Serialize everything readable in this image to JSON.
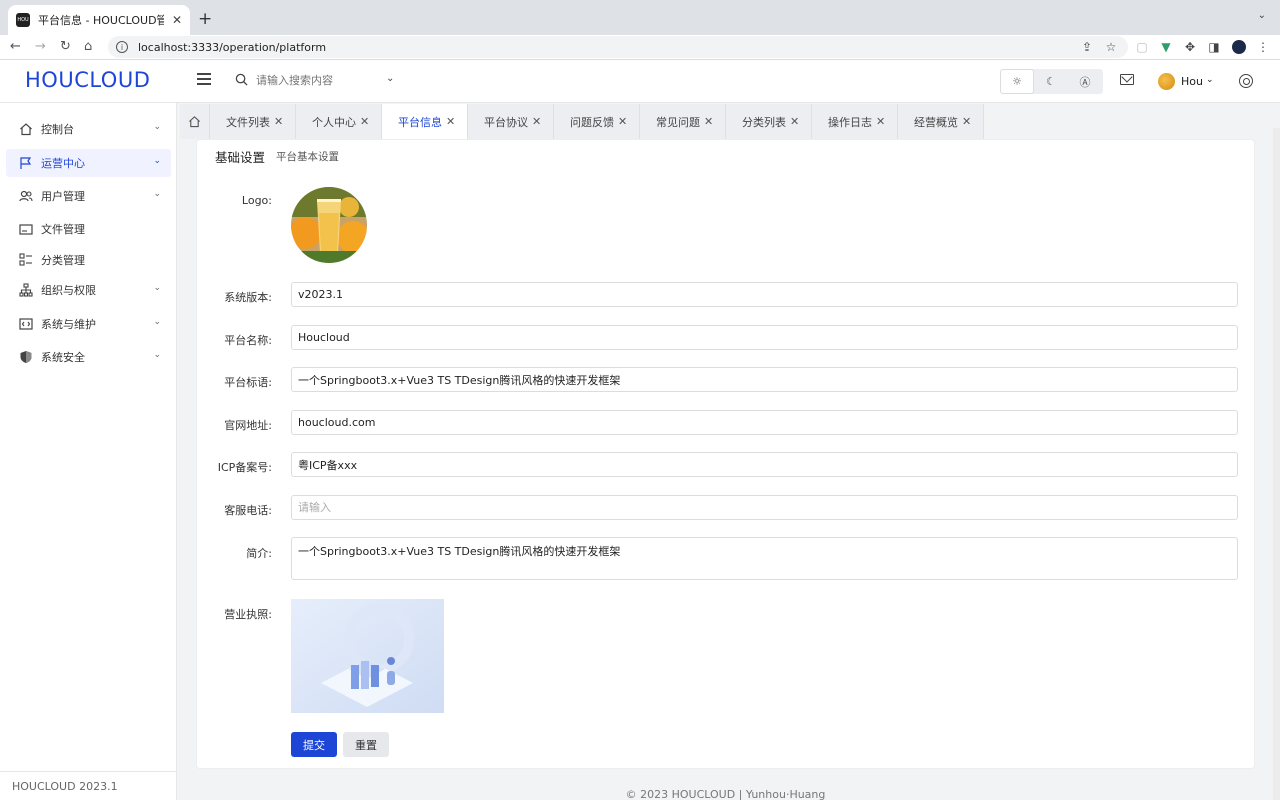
{
  "browser": {
    "tab_title": "平台信息 - HOUCLOUD管理端",
    "tab_favicon": "HOU",
    "url": "localhost:3333/operation/platform",
    "new_tab": "+",
    "close": "✕"
  },
  "header": {
    "logo": "HOUCLOUD",
    "search_placeholder": "请输入搜索内容",
    "user_name": "Hou",
    "theme_options": [
      "light-theme-icon",
      "dark-theme-icon",
      "auto-theme-icon"
    ]
  },
  "sidebar": {
    "items": [
      {
        "label": "控制台",
        "icon": "home-icon",
        "expandable": true
      },
      {
        "label": "运营中心",
        "icon": "flag-icon",
        "expandable": true,
        "active": true
      },
      {
        "label": "用户管理",
        "icon": "users-icon",
        "expandable": true
      },
      {
        "label": "文件管理",
        "icon": "folder-icon",
        "expandable": false
      },
      {
        "label": "分类管理",
        "icon": "category-icon",
        "expandable": false
      },
      {
        "label": "组织与权限",
        "icon": "org-icon",
        "expandable": true
      },
      {
        "label": "系统与维护",
        "icon": "code-icon",
        "expandable": true
      },
      {
        "label": "系统安全",
        "icon": "shield-icon",
        "expandable": true
      }
    ],
    "footer": "HOUCLOUD 2023.1"
  },
  "tabs": [
    {
      "label": "文件列表"
    },
    {
      "label": "个人中心"
    },
    {
      "label": "平台信息",
      "active": true
    },
    {
      "label": "平台协议"
    },
    {
      "label": "问题反馈"
    },
    {
      "label": "常见问题"
    },
    {
      "label": "分类列表"
    },
    {
      "label": "操作日志"
    },
    {
      "label": "经营概览"
    }
  ],
  "card": {
    "title": "基础设置",
    "subtitle": "平台基本设置"
  },
  "form": {
    "logo_label": "Logo:",
    "version_label": "系统版本:",
    "version_value": "v2023.1",
    "name_label": "平台名称:",
    "name_value": "Houcloud",
    "slogan_label": "平台标语:",
    "slogan_value": "一个Springboot3.x+Vue3 TS TDesign腾讯风格的快速开发框架",
    "website_label": "官网地址:",
    "website_value": "houcloud.com",
    "icp_label": "ICP备案号:",
    "icp_value": "粤ICP备xxx",
    "phone_label": "客服电话:",
    "phone_placeholder": "请输入",
    "intro_label": "简介:",
    "intro_value": "一个Springboot3.x+Vue3 TS TDesign腾讯风格的快速开发框架",
    "license_label": "营业执照:",
    "submit_label": "提交",
    "reset_label": "重置"
  },
  "footer": {
    "text": "© 2023 HOUCLOUD  |  Yunhou·Huang"
  },
  "colors": {
    "accent": "#1e46d6",
    "active_menu_bg": "#f0f3ff"
  }
}
